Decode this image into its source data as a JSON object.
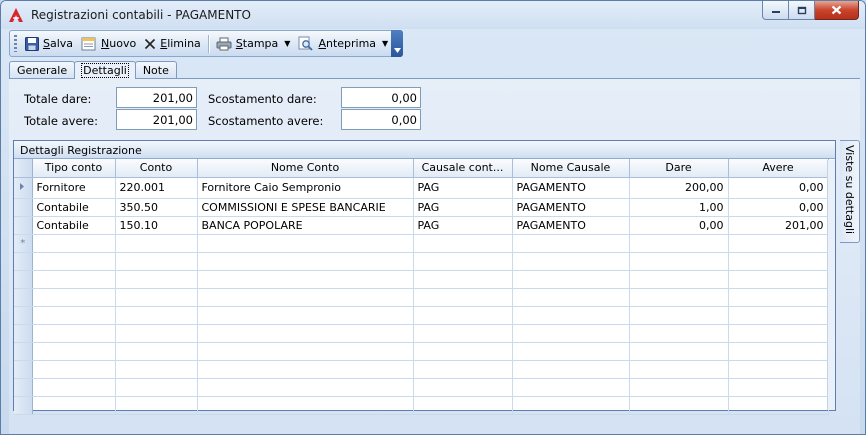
{
  "window": {
    "title": "Registrazioni contabili - PAGAMENTO"
  },
  "toolbar": {
    "save": {
      "u": "S",
      "rest": "alva",
      "icon": "floppy-disk-icon"
    },
    "new": {
      "u": "N",
      "rest": "uovo",
      "icon": "new-document-icon"
    },
    "delete": {
      "u": "E",
      "rest": "limina",
      "icon": "delete-x-icon"
    },
    "print": {
      "u": "S",
      "rest": "tampa",
      "icon": "printer-icon"
    },
    "preview": {
      "u": "A",
      "rest": "nteprima",
      "icon": "magnifier-icon"
    }
  },
  "tabs": [
    "Generale",
    "Dettagli",
    "Note"
  ],
  "totals": {
    "totale_dare_label": "Totale dare:",
    "totale_dare": "201,00",
    "totale_avere_label": "Totale avere:",
    "totale_avere": "201,00",
    "scost_dare_label": "Scostamento dare:",
    "scost_dare": "0,00",
    "scost_avere_label": "Scostamento avere:",
    "scost_avere": "0,00"
  },
  "grid": {
    "caption": "Dettagli Registrazione",
    "columns": [
      "Tipo conto",
      "Conto",
      "Nome Conto",
      "Causale cont...",
      "Nome Causale",
      "Dare",
      "Avere"
    ],
    "rows": [
      [
        "Fornitore",
        "220.001",
        "Fornitore Caio Sempronio",
        "PAG",
        "PAGAMENTO",
        "200,00",
        "0,00"
      ],
      [
        "Contabile",
        "350.50",
        "COMMISSIONI E SPESE BANCARIE",
        "PAG",
        "PAGAMENTO",
        "1,00",
        "0,00"
      ],
      [
        "Contabile",
        "150.10",
        "BANCA POPOLARE",
        "PAG",
        "PAGAMENTO",
        "0,00",
        "201,00"
      ]
    ]
  },
  "side_tab": "Viste su dettagli",
  "colors": {
    "accent": "#2a559a",
    "close_button": "#c8442c",
    "grid_border": "#5c7fb0"
  }
}
